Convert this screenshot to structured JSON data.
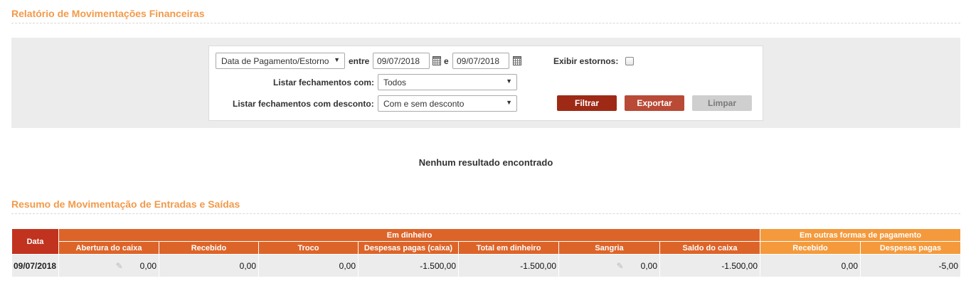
{
  "page": {
    "title": "Relatório de Movimentações Financeiras",
    "summary_title": "Resumo de Movimentação de Entradas e Saídas",
    "no_result": "Nenhum resultado encontrado"
  },
  "filters": {
    "date_type": "Data de Pagamento/Estorno",
    "between_label": "entre",
    "date_from": "09/07/2018",
    "and_label": "e",
    "date_to": "09/07/2018",
    "show_reversals_label": "Exibir estornos:",
    "show_reversals_checked": false,
    "closings_label": "Listar fechamentos com:",
    "closings_value": "Todos",
    "discount_label": "Listar fechamentos com desconto:",
    "discount_value": "Com e sem desconto"
  },
  "buttons": {
    "filter": "Filtrar",
    "export": "Exportar",
    "clear": "Limpar"
  },
  "icons": {
    "dropdown": "chevron-down-icon",
    "date_picker": "calendar-icon",
    "edit": "pencil-icon"
  },
  "colors": {
    "title": "#f29a4a",
    "filter_button": "#9e2a16",
    "export_button": "#b94a36",
    "date_header": "#c1331e",
    "cash_header": "#dd6429",
    "other_header": "#f49a3c"
  },
  "table": {
    "date_header": "Data",
    "cash_group": "Em dinheiro",
    "other_group": "Em outras formas de pagamento",
    "columns": [
      "Abertura do caixa",
      "Recebido",
      "Troco",
      "Despesas pagas (caixa)",
      "Total em dinheiro",
      "Sangria",
      "Saldo do caixa",
      "Recebido",
      "Despesas pagas"
    ],
    "rows": [
      {
        "date": "09/07/2018",
        "opening": "0,00",
        "received": "0,00",
        "change": "0,00",
        "expenses_cash": "-1.500,00",
        "total_cash": "-1.500,00",
        "withdrawal": "0,00",
        "balance": "-1.500,00",
        "other_received": "0,00",
        "other_expenses": "-5,00"
      }
    ]
  }
}
